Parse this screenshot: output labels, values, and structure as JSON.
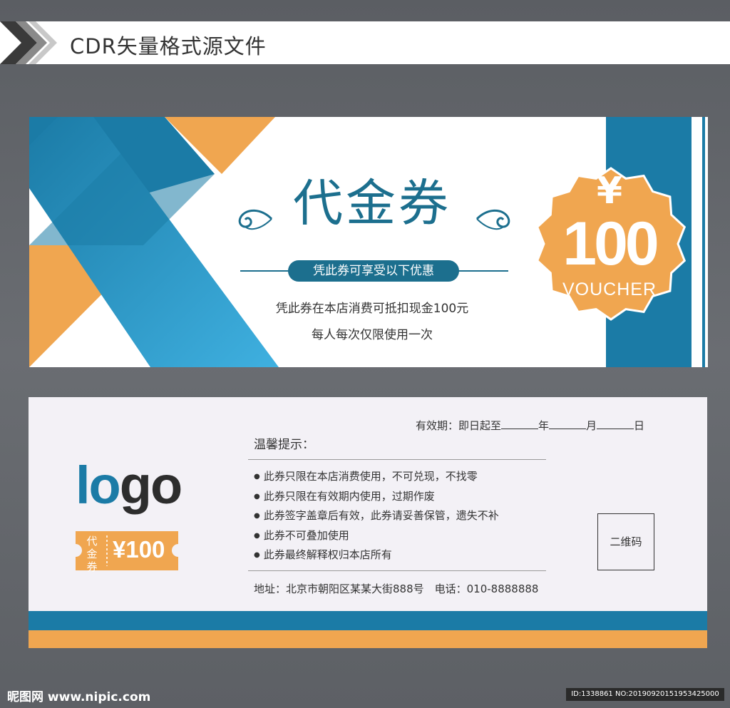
{
  "header": {
    "title": "CDR矢量格式源文件"
  },
  "front": {
    "title": "代金券",
    "subtitle": "凭此券可享受以下优惠",
    "lines": [
      "凭此券在本店消费可抵扣现金100元",
      "每人每次仅限使用一次"
    ],
    "badge": {
      "currency": "¥",
      "amount": "100",
      "label": "VOUCHER"
    }
  },
  "back": {
    "logo_part1": "lo",
    "logo_part2": "go",
    "ticket": {
      "label": "代金券",
      "amount": "¥100"
    },
    "validity": {
      "prefix": "有效期：即日起至",
      "year": "年",
      "month": "月",
      "day": "日"
    },
    "tips_title": "温馨提示：",
    "tips": [
      "此券只限在本店消费使用，不可兑现，不找零",
      "此券只限在有效期内使用，过期作废",
      "此券签字盖章后有效，此券请妥善保管，遗失不补",
      "此券不可叠加使用",
      "此券最终解释权归本店所有"
    ],
    "address": "地址：北京市朝阳区某某大街888号　电话：010-8888888",
    "qr_label": "二维码"
  },
  "watermark": {
    "left": "昵图网 www.nipic.com",
    "right": "ID:1338861 NO:20190920151953425000"
  },
  "colors": {
    "blue": "#1b7ba6",
    "light_blue": "#17a3dc",
    "orange": "#f0a650",
    "teal": "#1c6f8e"
  }
}
